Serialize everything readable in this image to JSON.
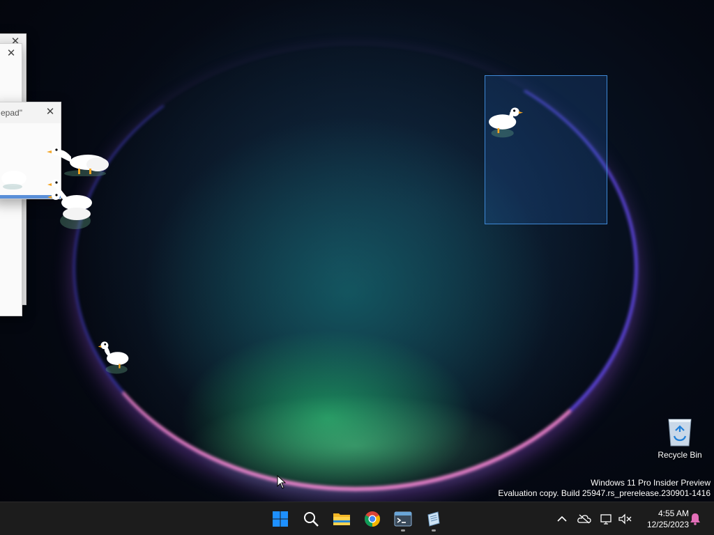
{
  "desktop": {
    "windows": {
      "back_close_label": "✕",
      "front_title": "epad\"",
      "front_close_label": "✕"
    },
    "recycle_bin": {
      "label": "Recycle Bin"
    },
    "watermark": {
      "line1": "Windows 11 Pro Insider Preview",
      "line2": "Evaluation copy. Build 25947.rs_prerelease.230901-1416"
    },
    "geese_icon": "goose-icon"
  },
  "taskbar": {
    "apps": [
      {
        "name": "start-button",
        "icon": "windows-logo-icon"
      },
      {
        "name": "search-button",
        "icon": "search-icon"
      },
      {
        "name": "file-explorer-button",
        "icon": "folder-icon"
      },
      {
        "name": "chrome-button",
        "icon": "chrome-icon"
      },
      {
        "name": "terminal-button",
        "icon": "terminal-icon"
      },
      {
        "name": "notepad-button",
        "icon": "notepad-icon"
      }
    ],
    "tray": {
      "time": "4:55 AM",
      "date": "12/25/2023"
    }
  },
  "colors": {
    "taskbar_bg": "#1c1c1c",
    "selection_border": "#3f8ad8",
    "windows_blue": "#1e90ff"
  }
}
